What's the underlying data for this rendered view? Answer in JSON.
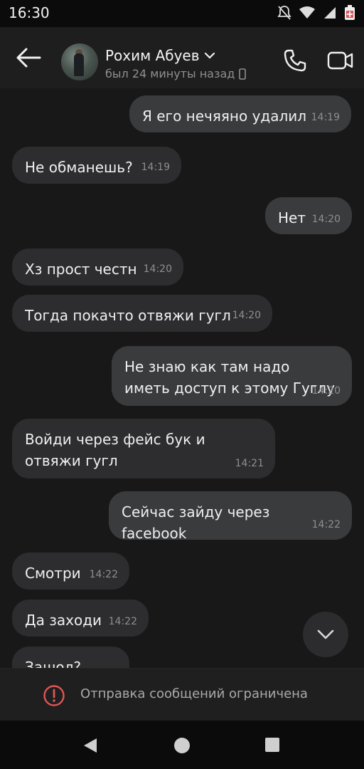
{
  "status_bar": {
    "time": "16:30"
  },
  "header": {
    "contact_name": "Рохим Абуев",
    "contact_status": "был 24 минуты назад"
  },
  "messages": [
    {
      "direction": "out",
      "text": "Я его нечяяно удалил",
      "time": "14:19"
    },
    {
      "direction": "in",
      "text": "Не обманешь?",
      "time": "14:19"
    },
    {
      "direction": "out",
      "text": "Нет",
      "time": "14:20"
    },
    {
      "direction": "in",
      "text": "Хз прост честн",
      "time": "14:20"
    },
    {
      "direction": "in",
      "text": "Тогда покачто отвяжи гугл",
      "time": "14:20"
    },
    {
      "direction": "out",
      "text": "Не знаю как там надо иметь доступ к этому Гуглу",
      "time": "14:20"
    },
    {
      "direction": "in",
      "text": "Войди через фейс бук и отвяжи гугл",
      "time": "14:21"
    },
    {
      "direction": "out",
      "text": "Сейчас зайду через facebook",
      "time": "14:22"
    },
    {
      "direction": "in",
      "text": "Смотри",
      "time": "14:22"
    },
    {
      "direction": "in",
      "text": "Да заходи",
      "time": "14:22"
    },
    {
      "direction": "in",
      "text": "Зашол?",
      "time": ""
    }
  ],
  "restriction": {
    "text": "Отправка сообщений ограничена"
  },
  "colors": {
    "background": "#181818",
    "incoming_bubble": "#2d2d2f",
    "outgoing_bubble": "#3a3b3d",
    "warning": "#e05555"
  }
}
